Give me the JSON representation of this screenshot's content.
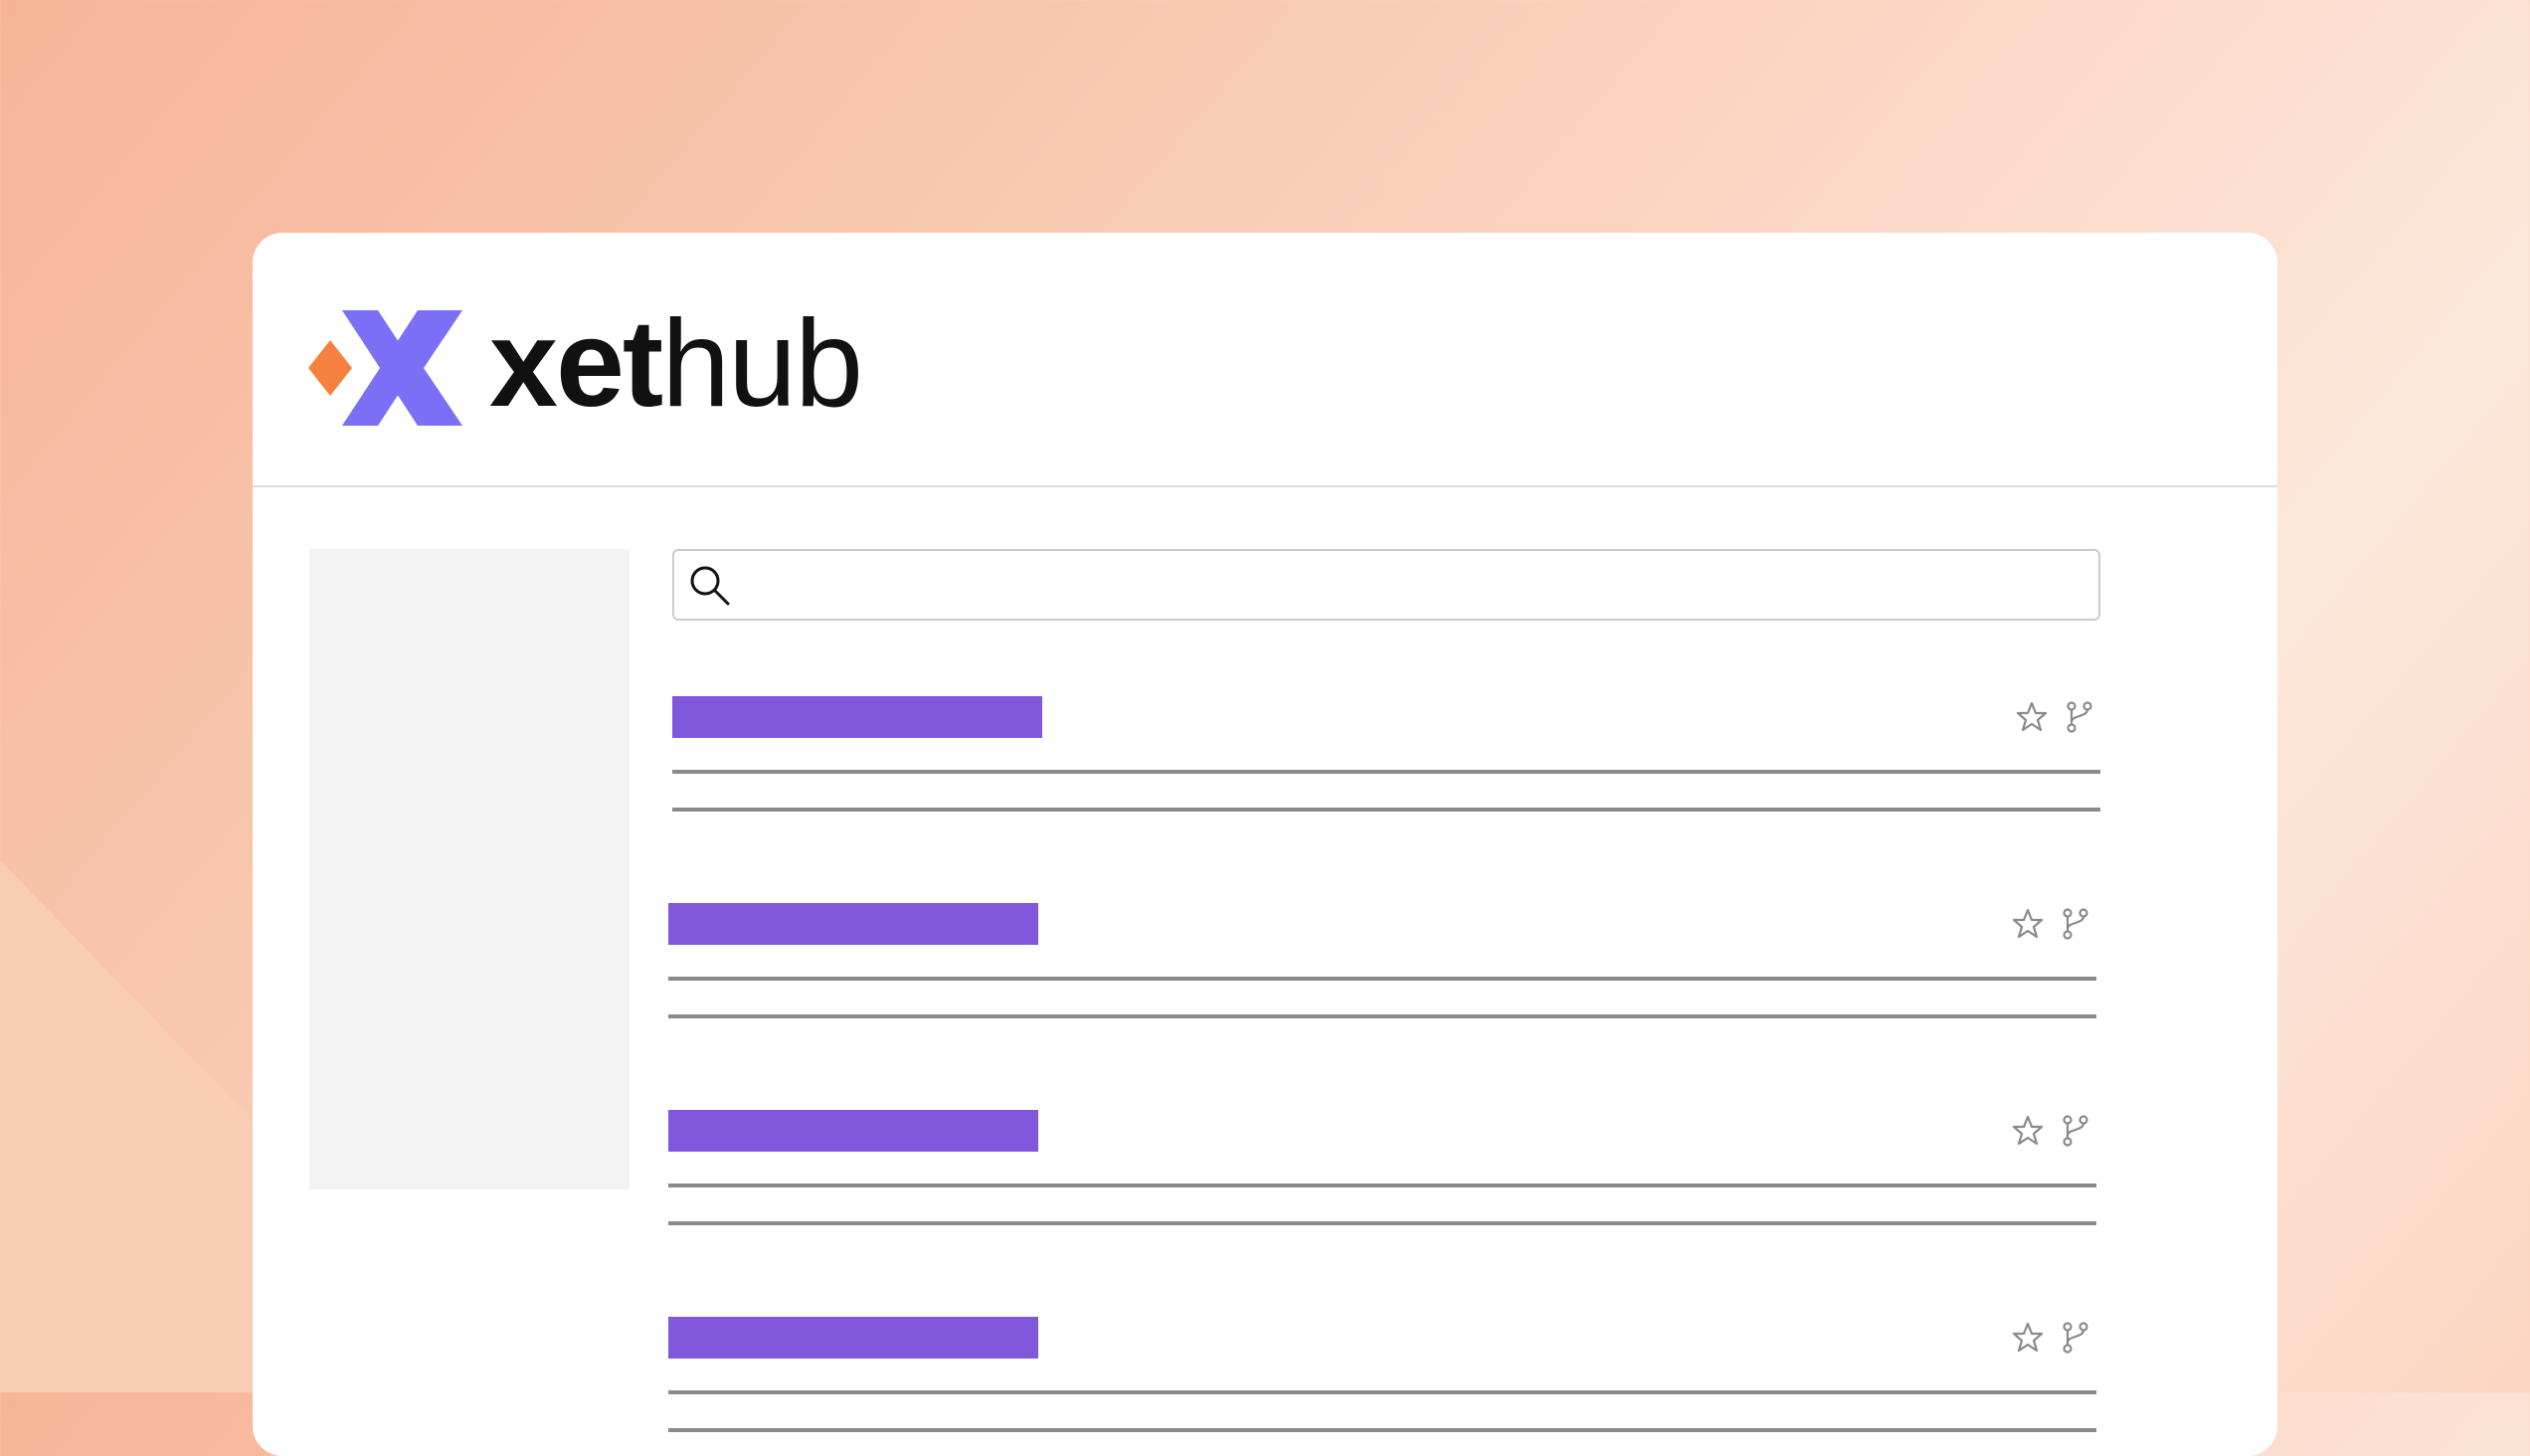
{
  "background": {
    "gradient_start": "#f6b597",
    "gradient_end": "#fde7db",
    "shape_color": "#f9ccb4"
  },
  "header": {
    "logo": {
      "icon": "xethub-logo-icon",
      "orange": "#f6813f",
      "purple": "#7b70f5"
    },
    "wordmark": {
      "bold_part": "xet",
      "light_part": "hub"
    }
  },
  "search": {
    "icon": "search-icon",
    "value": ""
  },
  "repo_list": {
    "title_color": "#8158db",
    "line_color": "#8a8a8a",
    "icons": [
      "star-icon",
      "fork-icon"
    ],
    "items": [
      {
        "id": 1
      },
      {
        "id": 2
      },
      {
        "id": 3
      },
      {
        "id": 4
      }
    ]
  }
}
